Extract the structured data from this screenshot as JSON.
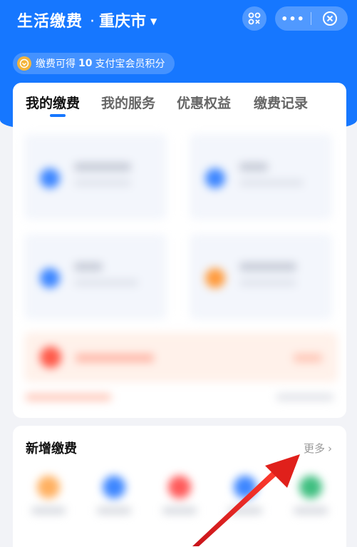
{
  "header": {
    "title": "生活缴费",
    "separator": "·",
    "city": "重庆市",
    "caret": "▼",
    "more_label": "•••"
  },
  "points": {
    "prefix": "缴费可得",
    "value": "10",
    "suffix": "支付宝会员积分"
  },
  "tabs": [
    {
      "label": "我的缴费",
      "active": true
    },
    {
      "label": "我的服务",
      "active": false
    },
    {
      "label": "优惠权益",
      "active": false
    },
    {
      "label": "缴费记录",
      "active": false
    }
  ],
  "new_payment": {
    "title": "新增缴费",
    "more": "更多",
    "chevron": "›"
  },
  "colors": {
    "brand": "#1677ff",
    "tile_blue": "#3d86ff",
    "tile_orange": "#ff9b3d",
    "banner_red": "#ff5a4a",
    "arrow_red": "#e0201b"
  }
}
